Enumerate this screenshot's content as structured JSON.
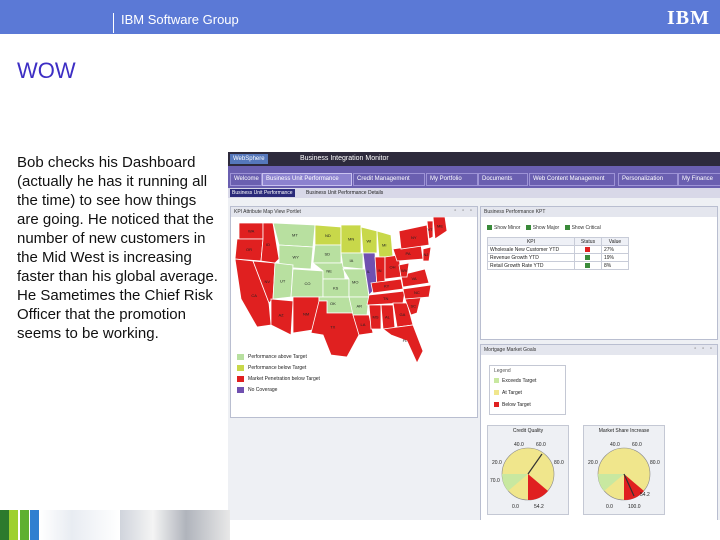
{
  "header": {
    "group": "IBM Software Group",
    "logo": "IBM"
  },
  "slide": {
    "title": "WOW",
    "body": "Bob checks his Dashboard (actually he has it running all the time) to see how things are going.  He noticed that the number of new customers in the Mid West is increasing faster than his global average.  He Sametimes the Chief Risk Officer that the promotion seems to be working."
  },
  "app": {
    "brand": "WebSphere",
    "name": "Business Integration Monitor",
    "tabs": [
      "Welcome",
      "Business Unit Performance",
      "Credit Management",
      "My Portfolio",
      "Documents",
      "Web Content Management",
      "Personalization",
      "My Finance"
    ],
    "subtabs": [
      "Business Unit Performance",
      "Business Unit Performance Details"
    ],
    "map_panel": {
      "title": "KPI Attribute Map View Portlet",
      "states": [
        "WA",
        "OR",
        "CA",
        "NV",
        "ID",
        "MT",
        "WY",
        "UT",
        "AZ",
        "CO",
        "NM",
        "ND",
        "SD",
        "NE",
        "KS",
        "OK",
        "TX",
        "MN",
        "IA",
        "MO",
        "AR",
        "LA",
        "WI",
        "IL",
        "MI",
        "IN",
        "OH",
        "KY",
        "TN",
        "MS",
        "AL",
        "GA",
        "FL",
        "SC",
        "NC",
        "VA",
        "WV",
        "PA",
        "NY",
        "VT",
        "ME",
        "NJ"
      ],
      "legend": [
        {
          "label": "Performance above Target",
          "color": "#b8e0a0"
        },
        {
          "label": "Performance below Target",
          "color": "#c8d84a"
        },
        {
          "label": "Market Penetration below Target",
          "color": "#e02020"
        },
        {
          "label": "No Coverage",
          "color": "#7050b0"
        }
      ]
    },
    "kpi_panel": {
      "title": "Business Performance KPT",
      "filters": [
        "Show Minor",
        "Show Major",
        "Show Critical"
      ],
      "columns": [
        "KPI",
        "Status",
        "Value"
      ],
      "rows": [
        {
          "kpi": "Wholesale New Customer YTD",
          "status": "red",
          "value": "27%"
        },
        {
          "kpi": "Revenue Growth YTD",
          "status": "green",
          "value": "19%"
        },
        {
          "kpi": "Retail Growth Rate YTD",
          "status": "green",
          "value": "8%"
        }
      ]
    },
    "market_panel": {
      "title": "Mortgage Market Goals",
      "legend_title": "Legend",
      "legend": [
        {
          "label": "Exceeds Target",
          "color": "#c8e8a0"
        },
        {
          "label": "At Target",
          "color": "#f0e68c"
        },
        {
          "label": "Below Target",
          "color": "#e02020"
        }
      ],
      "gauges": [
        {
          "title": "Credit Quality",
          "labels": [
            "40.0",
            "60.0",
            "20.0",
            "80.0",
            "70.0",
            "0.0",
            "54.2"
          ],
          "value": 54.2
        },
        {
          "title": "Market Share Increase",
          "labels": [
            "40.0",
            "60.0",
            "20.0",
            "80.0",
            "0.0",
            "100.0",
            "54.2"
          ],
          "value": 84
        }
      ]
    }
  },
  "footer": {
    "colors": [
      "#2d7a2d",
      "#9ed02f",
      "#5fb030",
      "#2f7fd0"
    ]
  }
}
